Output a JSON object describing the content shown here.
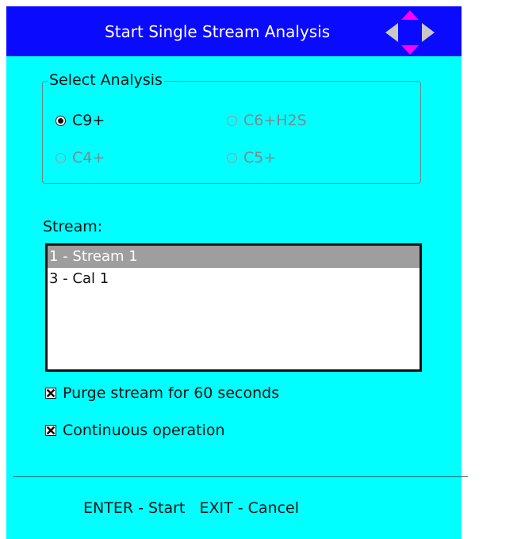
{
  "dialog": {
    "title": "Start Single Stream Analysis",
    "nav_icon": "four-way-arrow-pad-icon"
  },
  "analysis_group": {
    "legend": "Select Analysis",
    "options": [
      {
        "label": "C9+",
        "checked": true,
        "enabled": true
      },
      {
        "label": "C6+H2S",
        "checked": false,
        "enabled": false
      },
      {
        "label": "C4+",
        "checked": false,
        "enabled": false
      },
      {
        "label": "C5+",
        "checked": false,
        "enabled": false
      }
    ]
  },
  "stream": {
    "label": "Stream:",
    "items": [
      {
        "label": "1 - Stream 1",
        "selected": true
      },
      {
        "label": "3 - Cal 1",
        "selected": false
      }
    ]
  },
  "options": {
    "purge_label": "Purge stream for 60 seconds",
    "purge_checked": true,
    "continuous_label": "Continuous operation",
    "continuous_checked": true
  },
  "footer": {
    "hint": "ENTER - Start   EXIT - Cancel"
  },
  "colors": {
    "background": "#00ffff",
    "title_bar": "#0a0aff",
    "nav_arrow_left_right": "#c8c8c8",
    "nav_arrow_up_down": "#ff00ff",
    "selection": "#9e9e9e"
  }
}
